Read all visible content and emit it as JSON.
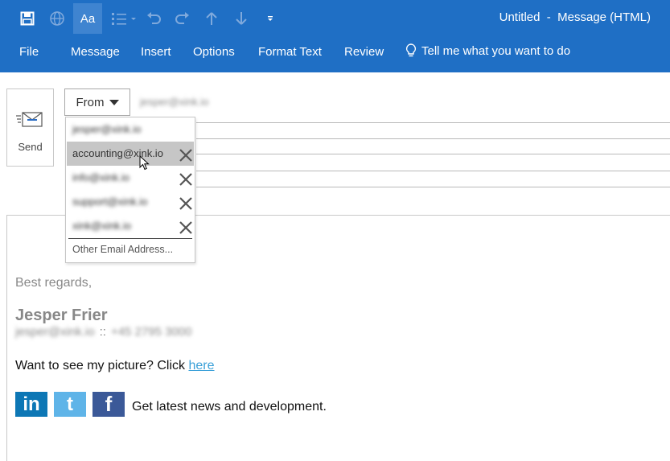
{
  "window": {
    "title": "Untitled  -  Message (HTML)"
  },
  "colors": {
    "ribbon": "#1f6fc5",
    "dropdown_highlight": "#c6c6c6",
    "link": "#3aa0d8",
    "linkedin": "#0d77b5",
    "twitter": "#5fb4e8",
    "facebook": "#3b5998"
  },
  "quick_access": [
    {
      "name": "save-icon"
    },
    {
      "name": "globe-icon"
    },
    {
      "name": "format-text-icon",
      "label": "Aa"
    },
    {
      "name": "bullet-list-icon"
    },
    {
      "name": "undo-icon"
    },
    {
      "name": "redo-icon"
    },
    {
      "name": "up-arrow-icon"
    },
    {
      "name": "down-arrow-icon"
    },
    {
      "name": "customize-icon"
    }
  ],
  "ribbon_tabs": [
    "File",
    "Message",
    "Insert",
    "Options",
    "Format Text",
    "Review"
  ],
  "tell_me": "Tell me what you want to do",
  "send": {
    "label": "Send"
  },
  "from": {
    "label": "From",
    "address": "jesper@xink.io"
  },
  "from_dropdown": {
    "items": [
      {
        "address": "jesper@xink.io",
        "removable": false,
        "highlighted": false
      },
      {
        "address": "accounting@xink.io",
        "removable": true,
        "highlighted": true
      },
      {
        "address": "info@xink.io",
        "removable": true,
        "highlighted": false
      },
      {
        "address": "support@xink.io",
        "removable": true,
        "highlighted": false
      },
      {
        "address": "xink@xink.io",
        "removable": true,
        "highlighted": false
      }
    ],
    "other": "Other Email Address..."
  },
  "signature": {
    "greeting": "Best regards,",
    "name": "Jesper Frier",
    "email": "jesper@xink.io",
    "separator": "::",
    "phone": "+45 2795 3000",
    "picture_text": "Want to see my picture? Click",
    "picture_link": "here",
    "social": {
      "linkedin": "in",
      "twitter": "t",
      "facebook": "f"
    },
    "news": "Get latest news and development."
  }
}
